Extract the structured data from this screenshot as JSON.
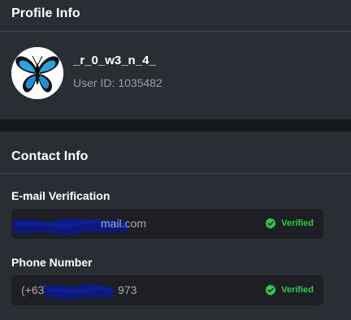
{
  "profile": {
    "title": "Profile Info",
    "username": "_r_0_w3_n_4_",
    "user_id_label": "User ID:",
    "user_id": "1035482",
    "avatar_icon": "butterfly-avatar-icon"
  },
  "contact": {
    "title": "Contact Info",
    "email": {
      "label": "E-mail Verification",
      "value_visible": "mail.com",
      "status": "Verified"
    },
    "phone": {
      "label": "Phone Number",
      "value_prefix": "(+63)",
      "value_suffix": "973",
      "status": "Verified"
    }
  },
  "colors": {
    "page_bg": "#18191d",
    "panel_bg": "#2b2d34",
    "field_bg": "#1e1f24",
    "muted_text": "#9a9ca4",
    "verified_green": "#2fcb4d",
    "redaction_blue": "#0b1a7a"
  }
}
